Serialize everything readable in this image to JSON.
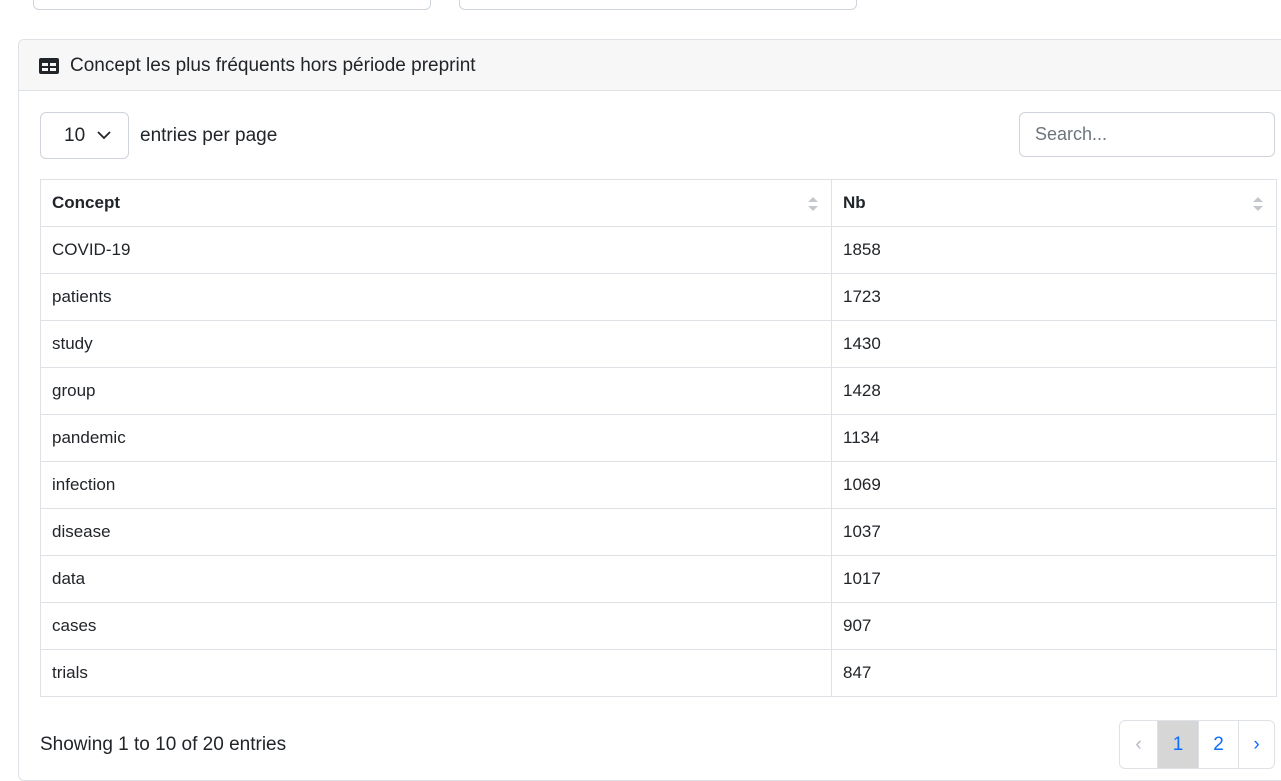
{
  "card": {
    "title": "Concept les plus fréquents hors période preprint",
    "icon": "table-icon"
  },
  "controls": {
    "entries_value": "10",
    "entries_label": "entries per page",
    "search_placeholder": "Search..."
  },
  "table": {
    "headers": [
      "Concept",
      "Nb"
    ],
    "rows": [
      [
        "COVID-19",
        "1858"
      ],
      [
        "patients",
        "1723"
      ],
      [
        "study",
        "1430"
      ],
      [
        "group",
        "1428"
      ],
      [
        "pandemic",
        "1134"
      ],
      [
        "infection",
        "1069"
      ],
      [
        "disease",
        "1037"
      ],
      [
        "data",
        "1017"
      ],
      [
        "cases",
        "907"
      ],
      [
        "trials",
        "847"
      ]
    ]
  },
  "footer": {
    "info": "Showing 1 to 10 of 20 entries",
    "pagination": {
      "prev": "‹",
      "pages": [
        "1",
        "2"
      ],
      "active": "1",
      "next": "›"
    }
  },
  "colors": {
    "accent": "#0d6efd",
    "border": "#dee2e6",
    "header_bg": "#f7f7f7",
    "active_page_bg": "#d6d6d6"
  }
}
